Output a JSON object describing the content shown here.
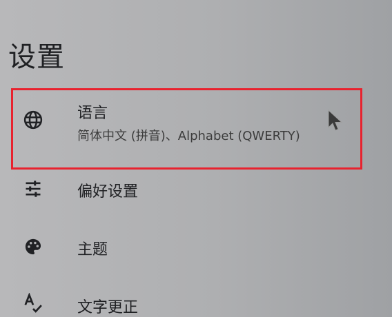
{
  "page": {
    "title": "设置"
  },
  "items": [
    {
      "label": "语言",
      "sublabel": "简体中文 (拼音)、Alphabet (QWERTY)",
      "icon": "globe-icon"
    },
    {
      "label": "偏好设置",
      "icon": "tune-sliders-icon"
    },
    {
      "label": "主题",
      "icon": "palette-icon"
    },
    {
      "label": "文字更正",
      "icon": "spellcheck-icon"
    }
  ],
  "colors": {
    "highlight": "#e8222e",
    "text": "#202124"
  }
}
